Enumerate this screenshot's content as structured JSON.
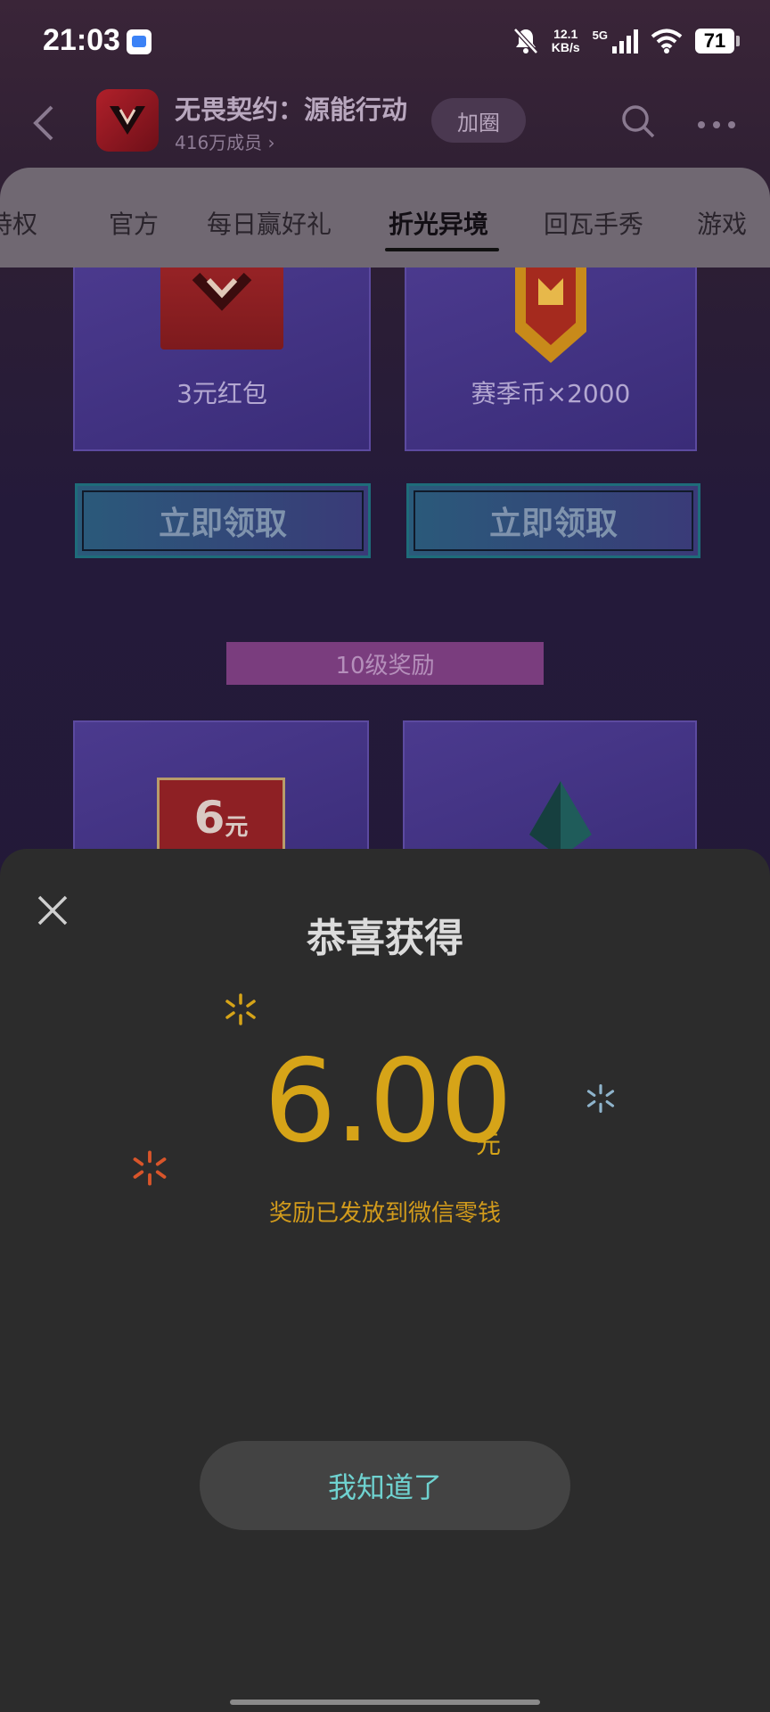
{
  "status_bar": {
    "time": "21:03",
    "net_speed_value": "12.1",
    "net_speed_unit": "KB/s",
    "network_type": "5G",
    "battery": "71"
  },
  "nav": {
    "group_title": "无畏契约：源能行动",
    "members": "416万成员 ›",
    "join_label": "加圈"
  },
  "tabs": [
    {
      "label": "特权"
    },
    {
      "label": "官方"
    },
    {
      "label": "每日赢好礼"
    },
    {
      "label": "折光异境"
    },
    {
      "label": "回瓦手秀"
    },
    {
      "label": "游戏"
    }
  ],
  "active_tab": "折光异境",
  "rewards": {
    "card_left_label": "3元红包",
    "card_right_label": "赛季币×2000",
    "claim_label": "立即领取",
    "level_banner": "10级奖励",
    "cash_tag_value": "6",
    "cash_tag_unit": "元"
  },
  "sheet": {
    "title": "恭喜获得",
    "amount": "6.00",
    "unit": "元",
    "note": "奖励已发放到微信零钱",
    "ok_label": "我知道了"
  },
  "colors": {
    "amount": "#d6a418",
    "ok_text": "#6fd2d0",
    "sheet_bg": "#2c2c2c"
  }
}
